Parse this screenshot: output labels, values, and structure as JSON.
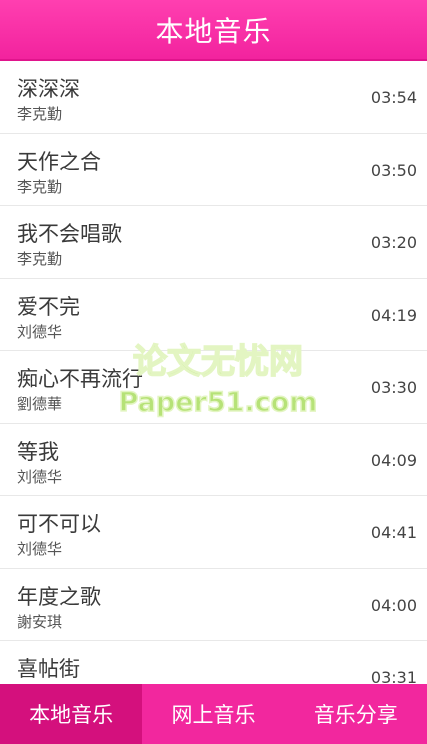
{
  "header": {
    "title": "本地音乐"
  },
  "songs": [
    {
      "title": "深深深",
      "artist": "李克勤",
      "duration": "03:54"
    },
    {
      "title": "天作之合",
      "artist": "李克勤",
      "duration": "03:50"
    },
    {
      "title": "我不会唱歌",
      "artist": "李克勤",
      "duration": "03:20"
    },
    {
      "title": "爱不完",
      "artist": "刘德华",
      "duration": "04:19"
    },
    {
      "title": "痴心不再流行",
      "artist": "劉德華",
      "duration": "03:30"
    },
    {
      "title": "等我",
      "artist": "刘德华",
      "duration": "04:09"
    },
    {
      "title": "可不可以",
      "artist": "刘德华",
      "duration": "04:41"
    },
    {
      "title": "年度之歌",
      "artist": "謝安琪",
      "duration": "04:00"
    },
    {
      "title": "喜帖街",
      "artist": "",
      "duration": "03:31"
    }
  ],
  "watermark": {
    "line1": "论文无忧网",
    "line2": "Paper51.com"
  },
  "tabs": [
    {
      "label": "本地音乐",
      "active": true
    },
    {
      "label": "网上音乐",
      "active": false
    },
    {
      "label": "音乐分享",
      "active": false
    }
  ],
  "colors": {
    "accent": "#f2279e",
    "active_tab": "#d4107d"
  }
}
